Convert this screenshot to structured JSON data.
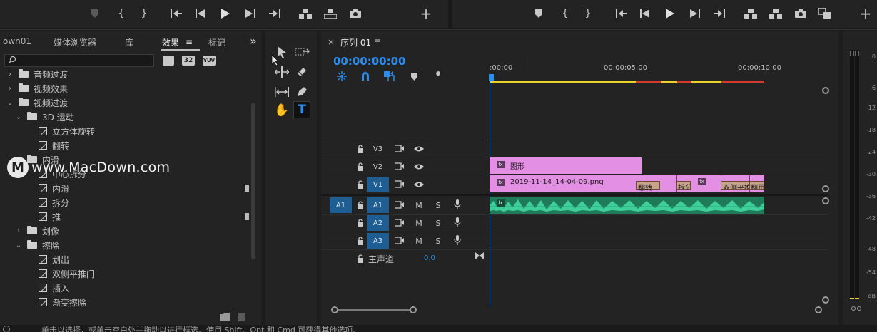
{
  "transport_left": {
    "icons": [
      "marker-icon",
      "mark-in-icon",
      "mark-out-icon",
      "go-to-in-icon",
      "step-back-icon",
      "play-icon",
      "step-forward-icon",
      "go-to-out-icon",
      "insert-icon",
      "overwrite-icon",
      "camera-icon",
      "add-icon"
    ]
  },
  "effects_panel": {
    "tabs": [
      {
        "label": "own01"
      },
      {
        "label": "媒体浏览器"
      },
      {
        "label": "库"
      },
      {
        "label": "效果",
        "active": true
      },
      {
        "label": "标记"
      }
    ],
    "overflow_label": "»",
    "search_placeholder": "",
    "badges": [
      "32",
      "YUV"
    ],
    "tree": [
      {
        "label": "音频过渡",
        "type": "folder",
        "level": 0,
        "expanded": false
      },
      {
        "label": "视频效果",
        "type": "folder",
        "level": 0,
        "expanded": false
      },
      {
        "label": "视频过渡",
        "type": "folder",
        "level": 0,
        "expanded": true
      },
      {
        "label": "3D 运动",
        "type": "folder",
        "level": 1,
        "expanded": true
      },
      {
        "label": "立方体旋转",
        "type": "effect",
        "level": 2
      },
      {
        "label": "翻转",
        "type": "effect",
        "level": 2
      },
      {
        "label": "内滑",
        "type": "folder",
        "level": 1,
        "expanded": true
      },
      {
        "label": "中心拆分",
        "type": "effect",
        "level": 2
      },
      {
        "label": "内滑",
        "type": "effect",
        "level": 2
      },
      {
        "label": "拆分",
        "type": "effect",
        "level": 2
      },
      {
        "label": "推",
        "type": "effect",
        "level": 2
      },
      {
        "label": "划像",
        "type": "folder",
        "level": 1,
        "expanded": false
      },
      {
        "label": "擦除",
        "type": "folder",
        "level": 1,
        "expanded": true
      },
      {
        "label": "划出",
        "type": "effect",
        "level": 2
      },
      {
        "label": "双侧平推门",
        "type": "effect",
        "level": 2
      },
      {
        "label": "插入",
        "type": "effect",
        "level": 2
      },
      {
        "label": "渐变擦除",
        "type": "effect",
        "level": 2
      }
    ]
  },
  "watermark": "www.MacDown.com",
  "tools": [
    "selection-tool",
    "track-select-tool",
    "ripple-edit-tool",
    "razor-tool",
    "slip-tool",
    "pen-tool",
    "hand-tool",
    "type-tool"
  ],
  "sequence": {
    "close": "×",
    "title": "序列 01",
    "menu": "≡",
    "timecode": "00:00:00:00",
    "ruler": [
      ":00:00",
      "00:00:05:00",
      "00:00:10:00"
    ],
    "tracks_video": [
      {
        "name": "V3"
      },
      {
        "name": "V2"
      },
      {
        "name": "V1",
        "source": ""
      }
    ],
    "tracks_audio": [
      {
        "name": "A1",
        "source": "A1",
        "m": "M",
        "s": "S"
      },
      {
        "name": "A2",
        "m": "M",
        "s": "S"
      },
      {
        "name": "A3",
        "m": "M",
        "s": "S"
      }
    ],
    "master": {
      "label": "主声道",
      "value": "0.0"
    },
    "clips": {
      "v2_label": "图形",
      "v1_label": "2019-11-14_14-04-09.png",
      "transitions": [
        "翻转",
        "拆分",
        "双侧平推",
        "翻页"
      ]
    }
  },
  "meter_labels": [
    "0",
    "-6",
    "-12",
    "-18",
    "-24",
    "-30",
    "-36",
    "-42",
    "-48",
    "-54",
    "dB"
  ],
  "status_bar": "单击以选择，或单击空白处并拖动以进行框选。使用 Shift、Opt 和 Cmd 可获得其他选项。",
  "colors": {
    "accent_blue": "#2d8ceb",
    "clip_pink": "#e38fe3",
    "audio_green": "#3fcf9a",
    "track_on": "#1e5e93"
  }
}
